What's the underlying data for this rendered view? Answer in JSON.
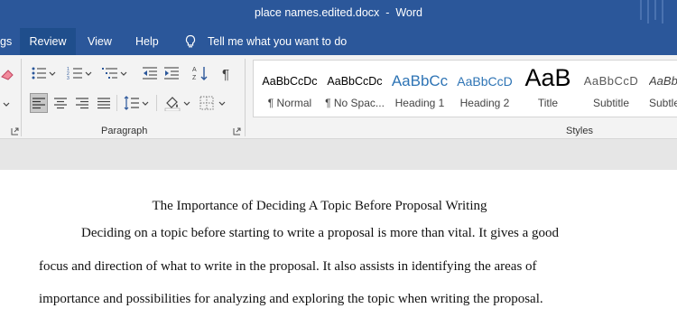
{
  "window": {
    "title": "place names.edited.docx  -  Word"
  },
  "tabs": {
    "items": [
      "gs",
      "Review",
      "View",
      "Help"
    ],
    "active": "Review",
    "tell_me": "Tell me what you want to do"
  },
  "ribbon": {
    "paragraph_label": "Paragraph",
    "styles_label": "Styles"
  },
  "styles": [
    {
      "preview": "AaBbCcDc",
      "name": "¶ Normal",
      "color": "#000000"
    },
    {
      "preview": "AaBbCcDc",
      "name": "¶ No Spac...",
      "color": "#000000"
    },
    {
      "preview": "AaBbCc",
      "name": "Heading 1",
      "color": "#2e74b5"
    },
    {
      "preview": "AaBbCcD",
      "name": "Heading 2",
      "color": "#2e74b5"
    },
    {
      "preview": "AaB",
      "name": "Title",
      "color": "#000000"
    },
    {
      "preview": "AaBbCcD",
      "name": "Subtitle",
      "color": "#595959"
    },
    {
      "preview": "AaBb",
      "name": "Subtle",
      "color": "#404040"
    }
  ],
  "document": {
    "title": "The Importance of Deciding A Topic Before Proposal Writing",
    "lines": [
      "Deciding on a topic before starting to write a proposal is more than vital. It gives a good",
      "focus and direction of what to write in the proposal. It also assists in identifying the areas of",
      "importance and possibilities for analyzing and exploring the topic when writing the proposal."
    ]
  },
  "colors": {
    "ribbon_blue": "#2b579a",
    "active_tab": "#1f4e8c",
    "ribbon_bg": "#f3f3f3",
    "heading_blue": "#2e74b5"
  }
}
